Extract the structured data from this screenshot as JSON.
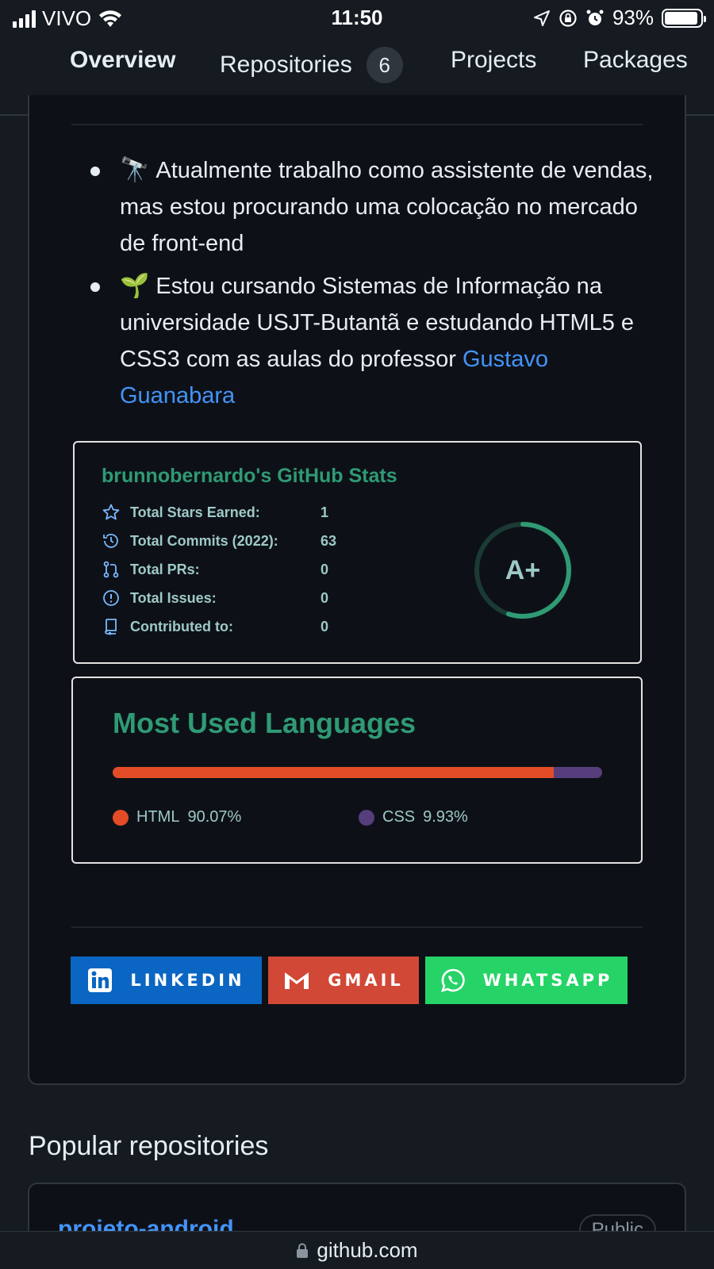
{
  "status_bar": {
    "carrier": "VIVO",
    "time": "11:50",
    "battery": "93%"
  },
  "tabs": [
    {
      "label": "Overview",
      "active": true
    },
    {
      "label": "Repositories",
      "count": "6"
    },
    {
      "label": "Projects"
    },
    {
      "label": "Packages"
    }
  ],
  "readme": {
    "bullets": [
      {
        "emoji": "🔭",
        "text": "Atualmente trabalho como assistente de vendas, mas estou procurando uma colocação no mercado de front-end"
      },
      {
        "emoji": "🌱",
        "text": "Estou cursando Sistemas de Informação na universidade USJT-Butantã e estudando HTML5 e CSS3 com as aulas do professor",
        "link": "Gustavo Guanabara"
      }
    ]
  },
  "stats_card": {
    "title": "brunnobernardo's GitHub Stats",
    "rows": [
      {
        "label": "Total Stars Earned:",
        "value": "1",
        "icon": "star-icon"
      },
      {
        "label": "Total Commits (2022):",
        "value": "63",
        "icon": "history-icon"
      },
      {
        "label": "Total PRs:",
        "value": "0",
        "icon": "pull-request-icon"
      },
      {
        "label": "Total Issues:",
        "value": "0",
        "icon": "issue-icon"
      },
      {
        "label": "Contributed to:",
        "value": "0",
        "icon": "repo-icon"
      }
    ],
    "grade": "A+",
    "grade_progress": 0.55,
    "accent": "#2f9a74"
  },
  "languages_card": {
    "title": "Most Used Languages",
    "languages": [
      {
        "name": "HTML",
        "percent": 90.07,
        "label": "90.07%",
        "color": "#e34c26"
      },
      {
        "name": "CSS",
        "percent": 9.93,
        "label": "9.93%",
        "color": "#563d7c"
      }
    ]
  },
  "social_buttons": [
    {
      "label": "LINKEDIN",
      "icon": "linkedin-icon",
      "color": "#0a66c2"
    },
    {
      "label": "GMAIL",
      "icon": "gmail-icon",
      "color": "#d14836"
    },
    {
      "label": "WHATSAPP",
      "icon": "whatsapp-icon",
      "color": "#25d366"
    }
  ],
  "popular": {
    "title": "Popular repositories",
    "repos": [
      {
        "name": "projeto-android",
        "visibility": "Public"
      }
    ]
  },
  "url_bar": {
    "url": "github.com"
  }
}
